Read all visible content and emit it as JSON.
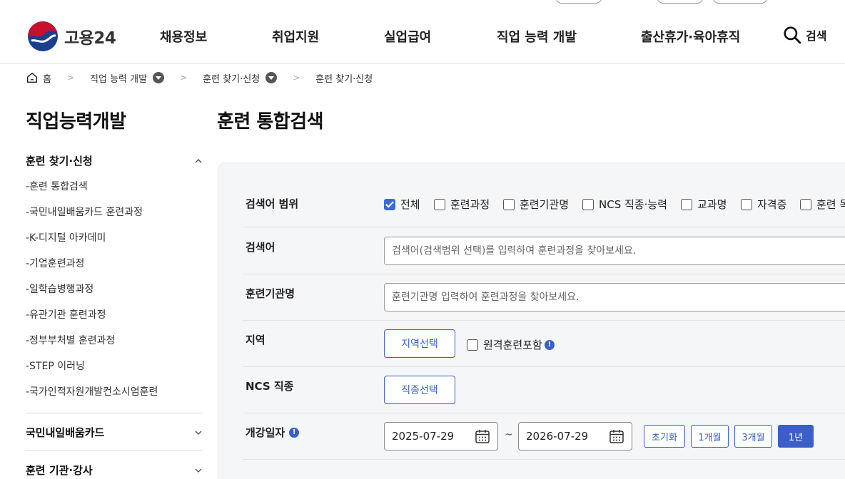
{
  "brand": {
    "name": "고용24"
  },
  "nav": {
    "items": [
      "채용정보",
      "취업지원",
      "실업급여",
      "직업 능력 개발",
      "출산휴가·육아휴직"
    ],
    "search_label": "검색"
  },
  "breadcrumb": {
    "home": "홈",
    "items": [
      "직업 능력 개발",
      "훈련 찾기·신청",
      "훈련 찾기·신청"
    ]
  },
  "sidebar": {
    "title": "직업능력개발",
    "sections": [
      {
        "label": "훈련 찾기·신청",
        "expanded": true,
        "items": [
          "-훈련 통합검색",
          "-국민내일배움카드 훈련과정",
          "-K-디지털 아카데미",
          "-기업훈련과정",
          "-일학습병행과정",
          "-유관기관 훈련과정",
          "-정부부처별 훈련과정",
          "-STEP 이러닝",
          "-국가인적자원개발컨소시엄훈련"
        ]
      },
      {
        "label": "국민내일배움카드",
        "expanded": false
      },
      {
        "label": "훈련 기관·강사",
        "expanded": false
      }
    ]
  },
  "main": {
    "title": "훈련 통합검색",
    "form": {
      "scope": {
        "label": "검색어 범위",
        "options": [
          {
            "label": "전체",
            "checked": true
          },
          {
            "label": "훈련과정",
            "checked": false
          },
          {
            "label": "훈련기관명",
            "checked": false
          },
          {
            "label": "NCS 직종·능력",
            "checked": false
          },
          {
            "label": "교과명",
            "checked": false
          },
          {
            "label": "자격증",
            "checked": false
          },
          {
            "label": "훈련 목",
            "checked": false
          }
        ]
      },
      "keyword": {
        "label": "검색어",
        "placeholder": "검색어(검색범위 선택)를 입력하여 훈련과정을 찾아보세요."
      },
      "institution": {
        "label": "훈련기관명",
        "placeholder": "훈련기관명 입력하여 훈련과정을 찾아보세요."
      },
      "region": {
        "label": "지역",
        "button": "지역선택",
        "remote_label": "원격훈련포함",
        "remote_checked": false
      },
      "ncs": {
        "label": "NCS 직종",
        "button": "직종선택"
      },
      "start_date": {
        "label": "개강일자",
        "from": "2025-07-29",
        "separator": "~",
        "to": "2026-07-29",
        "periods": [
          {
            "label": "초기화",
            "active": false
          },
          {
            "label": "1개월",
            "active": false
          },
          {
            "label": "3개월",
            "active": false
          },
          {
            "label": "1년",
            "active": true
          }
        ]
      }
    }
  },
  "colors": {
    "accent": "#3a5fc8",
    "check": "#3a6ad8",
    "panel_bg": "#f5f6f8"
  },
  "icons": [
    "logo-mark-icon",
    "search-icon",
    "home-icon",
    "dropdown-icon",
    "chevron-up-icon",
    "chevron-down-icon",
    "info-icon",
    "calendar-icon"
  ]
}
